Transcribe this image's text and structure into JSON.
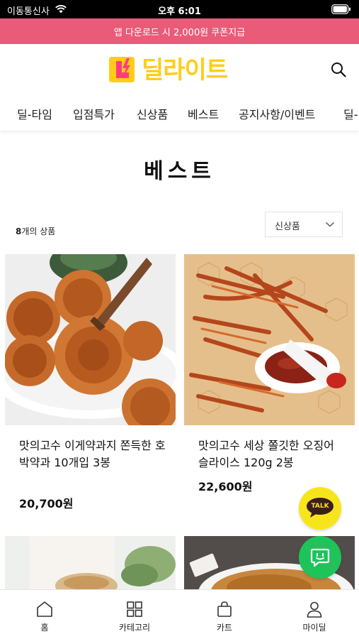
{
  "status_bar": {
    "carrier": "이동통신사",
    "time": "오후 6:01"
  },
  "promo_banner": "앱 다운로드 시 2,000원 쿠폰지급",
  "header": {
    "logo_text": "딜라이트",
    "logo_mark": "L"
  },
  "nav": {
    "tabs": [
      {
        "label": "딜-타임"
      },
      {
        "label": "입점특가"
      },
      {
        "label": "신상품"
      },
      {
        "label": "베스트"
      },
      {
        "label": "공지사항/이벤트"
      },
      {
        "label": "딜-"
      }
    ]
  },
  "page": {
    "title": "베스트",
    "count_number": "8",
    "count_suffix": "개의 상품"
  },
  "sort": {
    "selected": "신상품"
  },
  "products": [
    {
      "name": "맛의고수 이게약과지 쫀득한 호박약과 10개입 3봉",
      "price": "20,700원"
    },
    {
      "name": "맛의고수 세상 쫄깃한 오징어 슬라이스 120g 2봉",
      "price": "22,600원"
    }
  ],
  "floating": {
    "talk_label": "TALK"
  },
  "bottom_nav": {
    "items": [
      {
        "label": "홈",
        "icon": "home-icon"
      },
      {
        "label": "카테고리",
        "icon": "grid-icon"
      },
      {
        "label": "카트",
        "icon": "bag-icon"
      },
      {
        "label": "마이딜",
        "icon": "person-icon"
      }
    ]
  },
  "colors": {
    "banner": "#ea5b79",
    "logo_yellow": "#ffcc1a",
    "talk": "#f7e51b",
    "chat": "#1ec35a"
  }
}
